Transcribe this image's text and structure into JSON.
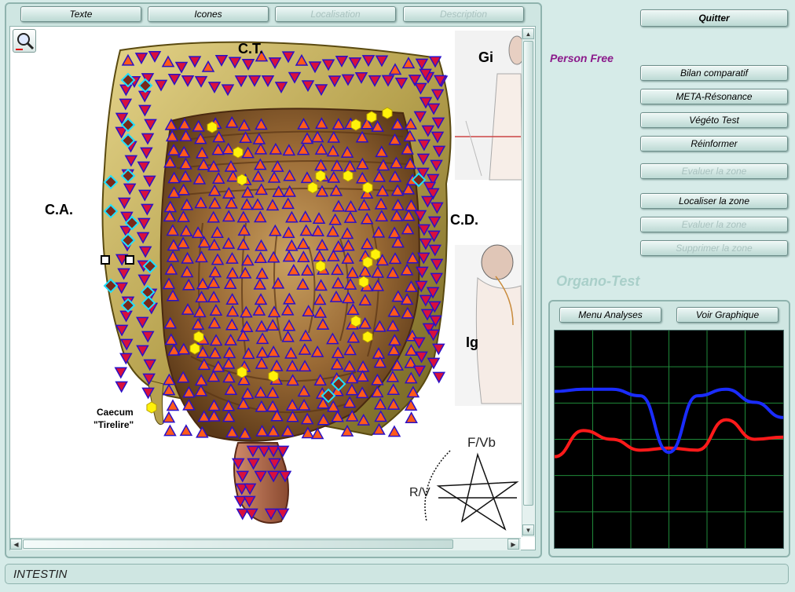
{
  "left_tabs": {
    "texte": "Texte",
    "icones": "Icones",
    "localisation": "Localisation",
    "description": "Description"
  },
  "viewer": {
    "labels": {
      "ct": "C.T.",
      "ca": "C.A.",
      "cd": "C.D.",
      "gi": "Gi",
      "ig": "Ig",
      "caecum_line1": "Caecum",
      "caecum_line2": "\"Tirelire\""
    },
    "pentagram": {
      "fvb": "F/Vb",
      "rv": "R/V"
    }
  },
  "right": {
    "quit": "Quitter",
    "person": "Person Free",
    "bilan": "Bilan comparatif",
    "meta": "META-Résonance",
    "vegeto": "Végéto Test",
    "renforcer": "Réinformer",
    "evaluer1": "Evaluer la zone",
    "localiser": "Localiser la zone",
    "evaluer2": "Evaluer la zone",
    "supprimer": "Supprimer la zone",
    "organo": "Organo-Test"
  },
  "graph": {
    "menu": "Menu Analyses",
    "voir": "Voir Graphique",
    "colors": {
      "blue": "#1a2cff",
      "red": "#ff1a1a",
      "grid": "#1f8a3a"
    },
    "blue_series": [
      0.28,
      0.27,
      0.27,
      0.3,
      0.56,
      0.3,
      0.27,
      0.33,
      0.4
    ],
    "red_series": [
      0.58,
      0.46,
      0.5,
      0.55,
      0.54,
      0.55,
      0.41,
      0.5,
      0.49
    ]
  },
  "status": {
    "text": "INTESTIN"
  }
}
